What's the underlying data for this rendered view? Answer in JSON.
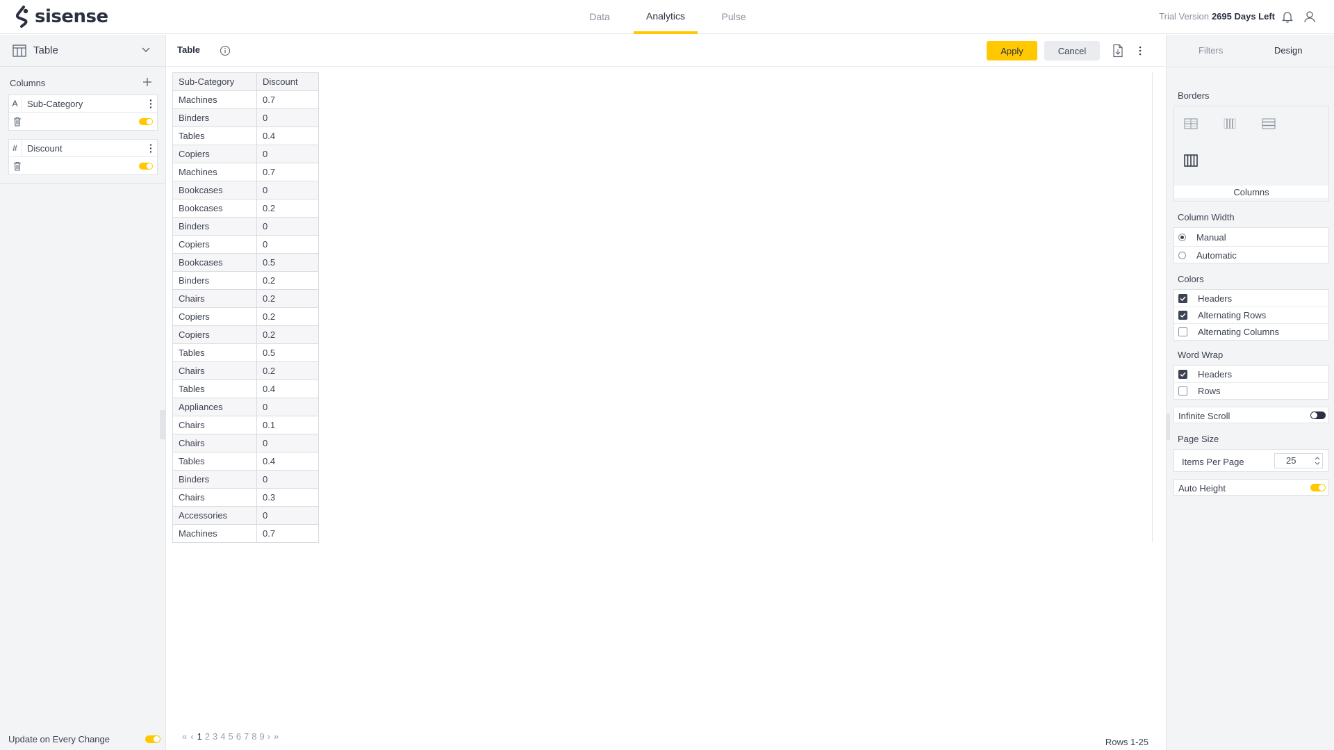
{
  "colors": {
    "accent": "#ffc800",
    "dark": "#2b3140",
    "muted": "#8a909c"
  },
  "app": {
    "logo_text": "sisense"
  },
  "nav": {
    "tabs": [
      {
        "label": "Data"
      },
      {
        "label": "Analytics"
      },
      {
        "label": "Pulse"
      }
    ],
    "active": "Analytics"
  },
  "trial": {
    "label": "Trial Version",
    "days": "2695 Days Left"
  },
  "left": {
    "widget_type": "Table",
    "columns_title": "Columns",
    "columns": [
      {
        "type_icon": "A",
        "name": "Sub-Category"
      },
      {
        "type_icon": "#",
        "name": "Discount"
      }
    ],
    "update_label": "Update on Every Change"
  },
  "main": {
    "title": "Table",
    "apply_label": "Apply",
    "cancel_label": "Cancel",
    "table": {
      "headers": [
        "Sub-Category",
        "Discount"
      ],
      "rows": [
        [
          "Machines",
          "0.7"
        ],
        [
          "Binders",
          "0"
        ],
        [
          "Tables",
          "0.4"
        ],
        [
          "Copiers",
          "0"
        ],
        [
          "Machines",
          "0.7"
        ],
        [
          "Bookcases",
          "0"
        ],
        [
          "Bookcases",
          "0.2"
        ],
        [
          "Binders",
          "0"
        ],
        [
          "Copiers",
          "0"
        ],
        [
          "Bookcases",
          "0.5"
        ],
        [
          "Binders",
          "0.2"
        ],
        [
          "Chairs",
          "0.2"
        ],
        [
          "Copiers",
          "0.2"
        ],
        [
          "Copiers",
          "0.2"
        ],
        [
          "Tables",
          "0.5"
        ],
        [
          "Chairs",
          "0.2"
        ],
        [
          "Tables",
          "0.4"
        ],
        [
          "Appliances",
          "0"
        ],
        [
          "Chairs",
          "0.1"
        ],
        [
          "Chairs",
          "0"
        ],
        [
          "Tables",
          "0.4"
        ],
        [
          "Binders",
          "0"
        ],
        [
          "Chairs",
          "0.3"
        ],
        [
          "Accessories",
          "0"
        ],
        [
          "Machines",
          "0.7"
        ]
      ]
    },
    "pager": {
      "first": "«",
      "prev": "‹",
      "pages": [
        "1",
        "2",
        "3",
        "4",
        "5",
        "6",
        "7",
        "8",
        "9"
      ],
      "active_page": "1",
      "next": "›",
      "last": "»"
    },
    "rows_info": "Rows 1-25"
  },
  "right": {
    "tabs": {
      "filters": "Filters",
      "design": "Design"
    },
    "borders": {
      "title": "Borders",
      "selected_label": "Columns"
    },
    "column_width": {
      "title": "Column Width",
      "options": [
        "Manual",
        "Automatic"
      ],
      "selected": "Manual"
    },
    "colors": {
      "title": "Colors",
      "options": [
        {
          "label": "Headers",
          "checked": true
        },
        {
          "label": "Alternating Rows",
          "checked": true
        },
        {
          "label": "Alternating Columns",
          "checked": false
        }
      ]
    },
    "word_wrap": {
      "title": "Word Wrap",
      "options": [
        {
          "label": "Headers",
          "checked": true
        },
        {
          "label": "Rows",
          "checked": false
        }
      ]
    },
    "infinite_scroll": {
      "label": "Infinite Scroll",
      "enabled": false
    },
    "page_size": {
      "title": "Page Size",
      "label": "Items Per Page",
      "value": "25"
    },
    "auto_height": {
      "label": "Auto Height",
      "enabled": true
    }
  }
}
